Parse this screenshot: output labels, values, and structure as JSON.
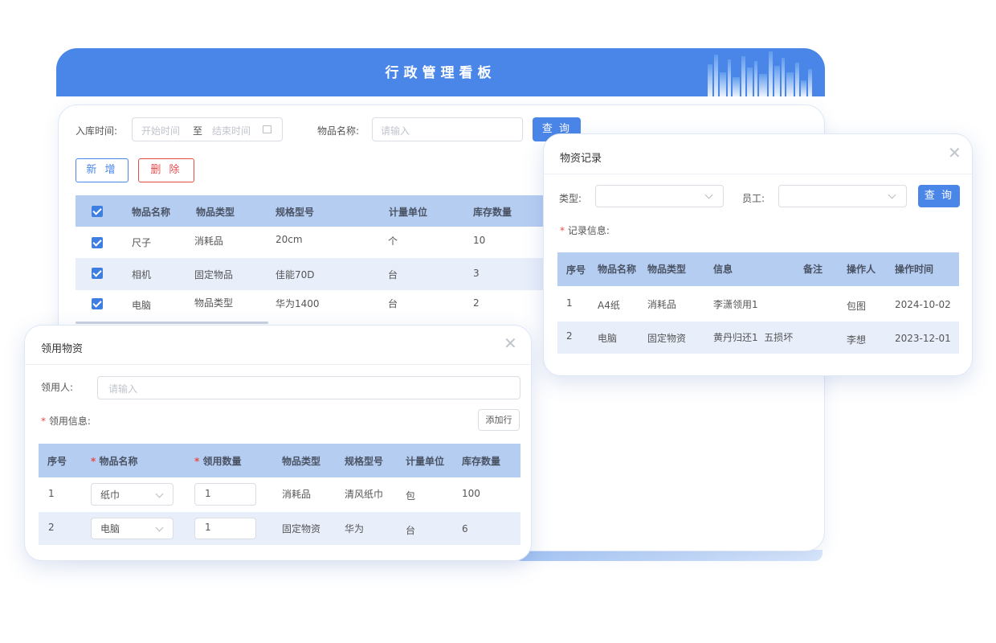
{
  "header": {
    "title": "行政管理看板"
  },
  "filters": {
    "in_time_label": "入库时间:",
    "start_placeholder": "开始时间",
    "range_sep": "至",
    "end_placeholder": "结束时间",
    "item_name_label": "物品名称:",
    "item_name_placeholder": "请输入",
    "query_button": "查 询"
  },
  "toolbar": {
    "add_button": "新 增",
    "delete_button": "删 除"
  },
  "main_table": {
    "columns": [
      "物品名称",
      "物品类型",
      "规格型号",
      "计量单位",
      "库存数量"
    ],
    "rows": [
      {
        "checked": true,
        "name": "尺子",
        "type": "消耗品",
        "spec": "20cm",
        "unit": "个",
        "stock": "10"
      },
      {
        "checked": true,
        "name": "相机",
        "type": "固定物品",
        "spec": "佳能70D",
        "unit": "台",
        "stock": "3"
      },
      {
        "checked": true,
        "name": "电脑",
        "type": "物品类型",
        "spec": "华为1400",
        "unit": "台",
        "stock": "2"
      }
    ]
  },
  "record_dialog": {
    "title": "物资记录",
    "type_label": "类型:",
    "employee_label": "员工:",
    "query_button": "查 询",
    "record_info_label": "记录信息:",
    "columns": [
      "序号",
      "物品名称",
      "物品类型",
      "信息",
      "备注",
      "操作人",
      "操作时间"
    ],
    "rows": [
      {
        "no": "1",
        "name": "A4纸",
        "type": "消耗品",
        "info": "李潇领用1",
        "remark": "",
        "operator": "包图",
        "time": "2024-10-02"
      },
      {
        "no": "2",
        "name": "电脑",
        "type": "固定物资",
        "info": "黄丹归还1  五损坏",
        "remark": "",
        "operator": "李想",
        "time": "2023-12-01"
      }
    ]
  },
  "receive_dialog": {
    "title": "领用物资",
    "receiver_label": "领用人:",
    "receiver_placeholder": "请输入",
    "receive_info_label": "领用信息:",
    "add_row_button": "添加行",
    "columns": [
      "序号",
      "物品名称",
      "领用数量",
      "物品类型",
      "规格型号",
      "计量单位",
      "库存数量"
    ],
    "rows": [
      {
        "no": "1",
        "name": "纸巾",
        "qty": "1",
        "type": "消耗品",
        "spec": "清风纸巾",
        "unit": "包",
        "stock": "100"
      },
      {
        "no": "2",
        "name": "电脑",
        "qty": "1",
        "type": "固定物资",
        "spec": "华为",
        "unit": "台",
        "stock": "6"
      }
    ]
  },
  "colors": {
    "primary": "#4a86e8",
    "danger": "#e54d4d",
    "table_header": "#b6cdf2",
    "row_alt": "#e8eefa"
  }
}
